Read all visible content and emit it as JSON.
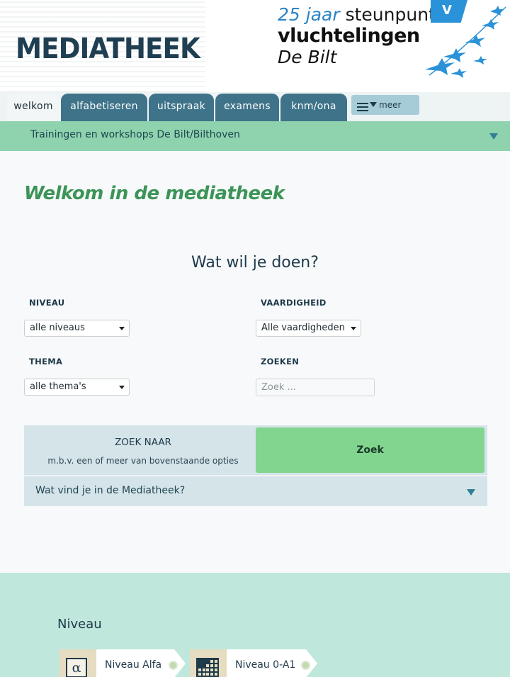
{
  "header": {
    "site_title": "MEDIATHEEK",
    "promo": {
      "years": "25 jaar",
      "word1": "steunpunt",
      "line2": "vluchtelingen",
      "line3": "De Bilt",
      "badge": "V"
    }
  },
  "tabs": [
    {
      "label": "welkom",
      "active": true
    },
    {
      "label": "alfabetiseren",
      "active": false
    },
    {
      "label": "uitspraak",
      "active": false
    },
    {
      "label": "examens",
      "active": false
    },
    {
      "label": "knm/ona",
      "active": false
    }
  ],
  "more_label": "meer",
  "trainings_bar": "Trainingen en workshops De Bilt/Bilthoven",
  "welcome_title": "Welkom in de mediatheek",
  "question": "Wat wil je doen?",
  "filters": {
    "niveau": {
      "label": "NIVEAU",
      "value": "alle niveaus"
    },
    "vaardigheid": {
      "label": "VAARDIGHEID",
      "value": "Alle vaardigheden"
    },
    "thema": {
      "label": "THEMA",
      "value": "alle thema's"
    },
    "zoeken": {
      "label": "ZOEKEN",
      "placeholder": "Zoek ..."
    }
  },
  "search_panel": {
    "title": "ZOEK NAAR",
    "subtitle": "m.b.v. een of meer van bovenstaande opties",
    "button": "Zoek",
    "find_label": "Wat vind je in de Mediatheek?"
  },
  "bottom": {
    "title": "Niveau",
    "levels": [
      {
        "label": "Niveau Alfa",
        "icon": "alpha-icon",
        "symbol": "α"
      },
      {
        "label": "Niveau 0-A1",
        "icon": "blocks-icon"
      }
    ]
  },
  "colors": {
    "tab_bg": "#3e7389",
    "train_bar": "#8fd3ae",
    "welcome_green": "#3c9458",
    "search_button": "#82d58e",
    "bottom_bg": "#bfe7dc"
  }
}
